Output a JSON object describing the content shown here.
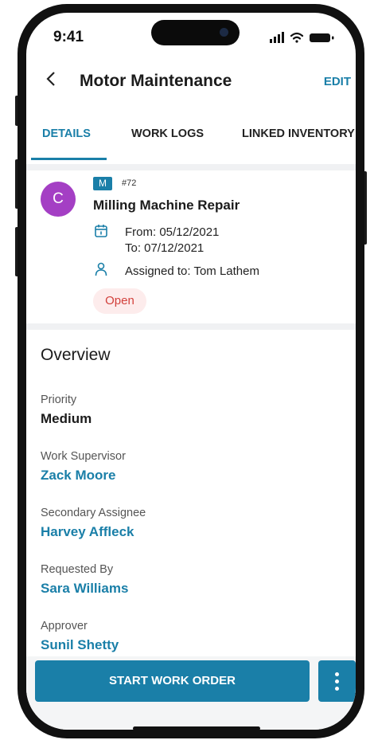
{
  "status_bar": {
    "time": "9:41"
  },
  "header": {
    "back_icon": "chevron-left-icon",
    "title": "Motor Maintenance",
    "edit_label": "EDIT"
  },
  "tabs": [
    {
      "label": "DETAILS",
      "active": true
    },
    {
      "label": "WORK LOGS",
      "active": false
    },
    {
      "label": "LINKED INVENTORY",
      "active": false
    }
  ],
  "work_order": {
    "avatar_letter": "C",
    "type_badge": "M",
    "number": "#72",
    "title": "Milling Machine Repair",
    "from": "From: 05/12/2021",
    "to": "To: 07/12/2021",
    "assigned": "Assigned to: Tom Lathem",
    "status": "Open"
  },
  "overview": {
    "title": "Overview",
    "fields": [
      {
        "label": "Priority",
        "value": "Medium"
      },
      {
        "label": "Work Supervisor",
        "value": "Zack Moore"
      },
      {
        "label": "Secondary Assignee",
        "value": "Harvey Affleck"
      },
      {
        "label": "Requested By",
        "value": "Sara Williams"
      },
      {
        "label": "Approver",
        "value": "Sunil Shetty"
      }
    ]
  },
  "actions": {
    "primary_label": "START WORK ORDER",
    "more_icon": "more-vertical-icon"
  },
  "colors": {
    "accent": "#1a7fa8",
    "avatar": "#a43fc4",
    "status_open_bg": "#fdecec",
    "status_open_text": "#d2403b"
  }
}
